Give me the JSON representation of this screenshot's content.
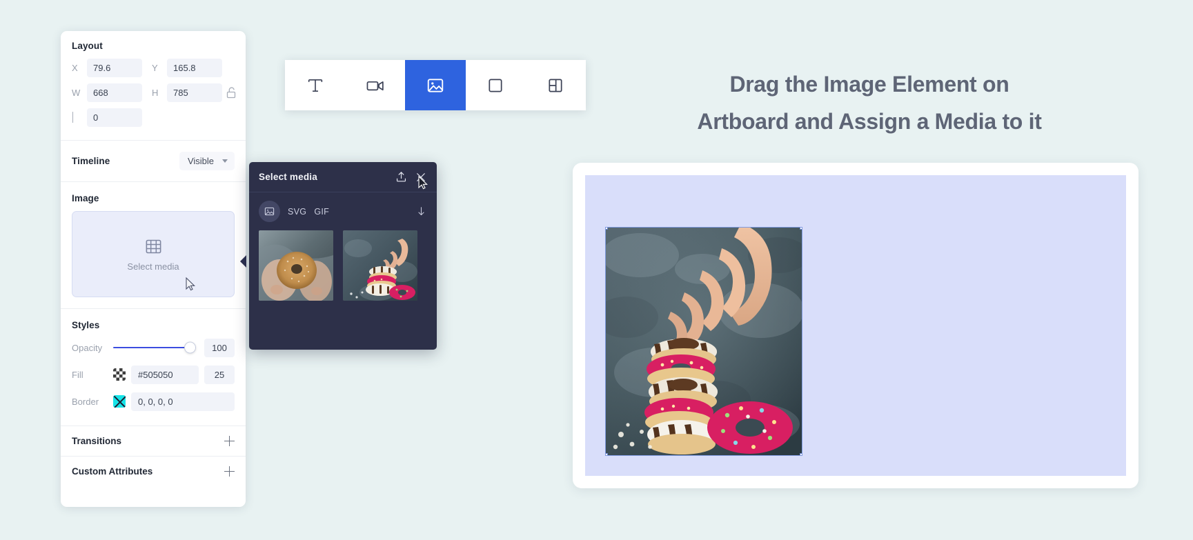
{
  "theme": {
    "page_bg": "#e8f2f2",
    "accent_blue": "#2e63df",
    "panel_bg": "#ffffff",
    "modal_bg": "#2d3049",
    "artboard_bg": "#d9defa",
    "heading_color": "#5e6576",
    "field_bg": "#f1f3f9"
  },
  "panel": {
    "layout": {
      "title": "Layout",
      "x_label": "X",
      "x_value": "79.6",
      "y_label": "Y",
      "y_value": "165.8",
      "w_label": "W",
      "w_value": "668",
      "h_label": "H",
      "h_value": "785",
      "radius_value": "0",
      "lock_icon": "unlock-icon"
    },
    "timeline": {
      "title": "Timeline",
      "visibility_value": "Visible"
    },
    "image": {
      "title": "Image",
      "dropzone_label": "Select media",
      "dropzone_icon": "film-grid-icon"
    },
    "styles": {
      "title": "Styles",
      "opacity_label": "Opacity",
      "opacity_value": "100",
      "fill_label": "Fill",
      "fill_value": "#505050",
      "fill_alpha": "25",
      "border_label": "Border",
      "border_value": "0, 0, 0, 0"
    },
    "transitions": {
      "title": "Transitions",
      "add_icon": "plus-icon"
    },
    "custom_attributes": {
      "title": "Custom Attributes",
      "add_icon": "plus-icon"
    }
  },
  "toolbar": {
    "tools": [
      {
        "name": "text-tool",
        "icon": "text-icon",
        "label": "T",
        "active": false
      },
      {
        "name": "video-tool",
        "icon": "video-icon",
        "label": "Video",
        "active": false
      },
      {
        "name": "image-tool",
        "icon": "image-icon",
        "label": "Image",
        "active": true
      },
      {
        "name": "shape-tool",
        "icon": "square-icon",
        "label": "Shape",
        "active": false
      },
      {
        "name": "layout-tool",
        "icon": "layout-icon",
        "label": "Layout",
        "active": false
      }
    ]
  },
  "media_modal": {
    "title": "Select media",
    "upload_icon": "upload-icon",
    "close_icon": "close-icon",
    "filter_icon": "image-icon",
    "filters": [
      "SVG",
      "GIF"
    ],
    "sort_icon": "arrow-down-icon",
    "thumbnails": [
      {
        "name": "media-thumbnail-donut-hands",
        "alt": "Hands holding a sugared donut"
      },
      {
        "name": "media-thumbnail-donut-stack",
        "alt": "Hand reaching for a stack of donuts"
      }
    ]
  },
  "instruction": {
    "line1": "Drag the Image Element on",
    "line2": "Artboard and Assign a Media to it"
  },
  "artboard": {
    "selected_image_alt": "Hand reaching toward a stack of frosted donuts",
    "handles": [
      "top-left",
      "top-right",
      "bottom-left",
      "bottom-right"
    ]
  }
}
